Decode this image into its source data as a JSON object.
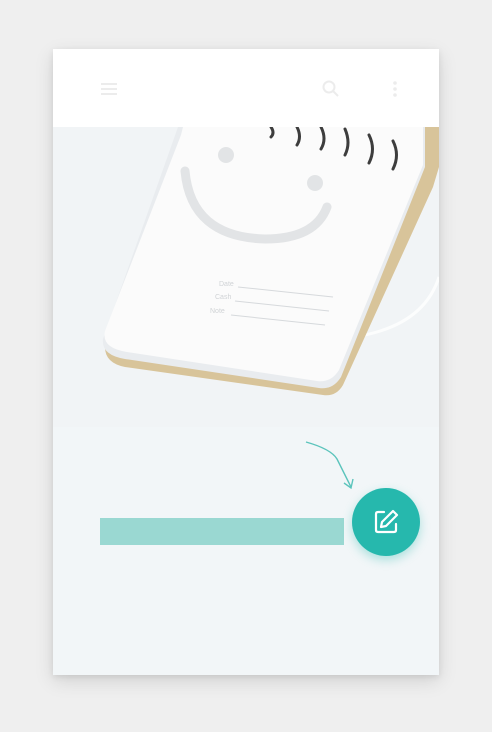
{
  "app": {
    "accent_color": "#26b8ad",
    "banner_color": "#9ad8d2",
    "background_color": "#f2f6f8"
  },
  "header": {
    "left_icon": "menu-icon",
    "right_icons": [
      "search-icon",
      "more-icon"
    ]
  },
  "illustration": {
    "subject": "notepad-with-smiley-icon",
    "form_lines": [
      "Date",
      "Cash",
      "Note"
    ]
  },
  "empty_state": {
    "banner_label": ""
  },
  "fab": {
    "icon": "new-note-icon",
    "label": ""
  }
}
